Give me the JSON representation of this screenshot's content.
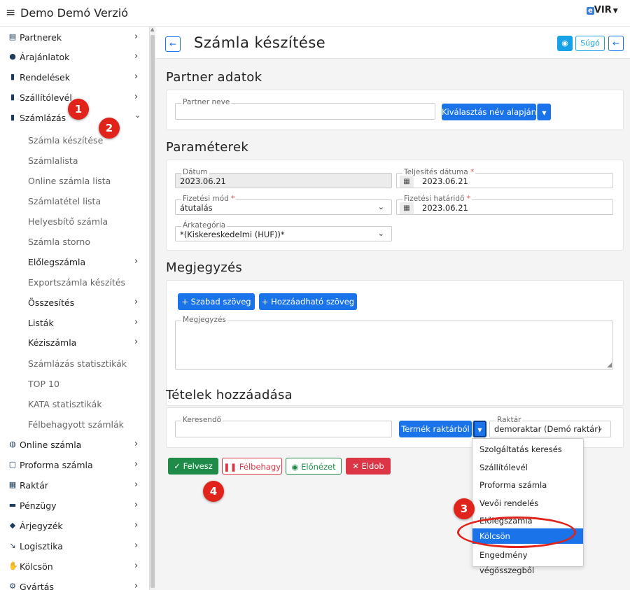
{
  "topbar": {
    "title": "Demo Demó Verzió",
    "brand": "VIR",
    "brand_e": "e"
  },
  "sidebar": {
    "items": [
      {
        "label": "Partnerek",
        "icon": "contact-book-icon"
      },
      {
        "label": "Árajánlatok",
        "icon": "chat-bubbles-icon"
      },
      {
        "label": "Rendelések",
        "icon": "document-icon"
      },
      {
        "label": "Szállítólevél",
        "icon": "clipboard-icon"
      },
      {
        "label": "Számlázás",
        "icon": "invoice-icon"
      }
    ],
    "subitems": [
      "Számla készítése",
      "Számlalista",
      "Online számla lista",
      "Számlatétel lista",
      "Helyesbítő számla",
      "Számla storno",
      "Előlegszámla",
      "Exportszámla készítés",
      "Összesítés",
      "Listák",
      "Kéziszámla",
      "Számlázás statisztikák",
      "TOP 10",
      "KATA statisztikák",
      "Félbehagyott számlák"
    ],
    "bottom": [
      {
        "label": "Online számla",
        "icon": "globe-icon"
      },
      {
        "label": "Proforma számla",
        "icon": "square-outline-icon"
      },
      {
        "label": "Raktár",
        "icon": "warehouse-icon"
      },
      {
        "label": "Pénzügy",
        "icon": "banknote-icon"
      },
      {
        "label": "Árjegyzék",
        "icon": "tags-icon"
      },
      {
        "label": "Logisztika",
        "icon": "dolly-icon"
      },
      {
        "label": "Kölcsön",
        "icon": "hand-holding-icon"
      },
      {
        "label": "Gyártás",
        "icon": "cogs-icon"
      }
    ]
  },
  "header": {
    "title": "Számla készítése",
    "help": "Súgó"
  },
  "partner": {
    "section": "Partner adatok",
    "name_label": "Partner neve",
    "name_value": "",
    "select_button": "Kiválasztás név alapján"
  },
  "params": {
    "section": "Paraméterek",
    "date_label": "Dátum",
    "date_value": "2023.06.21",
    "perf_label": "Teljesítés dátuma",
    "perf_value": "2023.06.21",
    "paymode_label": "Fizetési mód",
    "paymode_value": "átutalás",
    "deadline_label": "Fizetési határidő",
    "deadline_value": "2023.06.21",
    "pricecat_label": "Árkategória",
    "pricecat_value": "*(Kiskereskedelmi (HUF))*",
    "req": "*"
  },
  "notes": {
    "section": "Megjegyzés",
    "free_text": "Szabad szöveg",
    "add_text": "Hozzáadható szöveg",
    "field_label": "Megjegyzés",
    "plus": "+"
  },
  "items": {
    "section": "Tételek hozzáadása",
    "search_label": "Keresendő",
    "search_value": "",
    "from_stock": "Termék raktárból",
    "warehouse_label": "Raktár",
    "warehouse_value": "demoraktar (Demó raktár)"
  },
  "dropdown": [
    "Szolgáltatás keresés",
    "Szállítólevél",
    "Proforma számla",
    "Vevői rendelés",
    "Előlegszámla",
    "Kölcsön",
    "Engedmény végösszegből"
  ],
  "actions": {
    "add": "Felvesz",
    "pause": "Félbehagy",
    "preview": "Előnézet",
    "discard": "Eldob"
  },
  "badges": [
    "1",
    "2",
    "3",
    "4"
  ],
  "colors": {
    "primary": "#1a73e8",
    "success": "#1f8b48",
    "danger": "#dc3545",
    "badge": "#e0241b"
  }
}
